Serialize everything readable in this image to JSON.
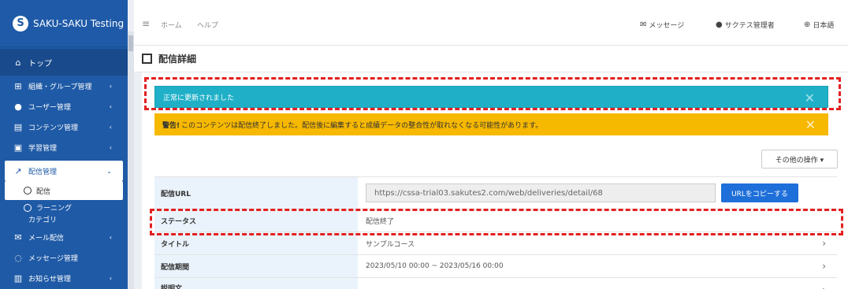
{
  "brand": {
    "logo_letter": "S",
    "name": "SAKU-SAKU Testing"
  },
  "sidebar": {
    "items": [
      {
        "label": "トップ",
        "icon": "home-icon"
      },
      {
        "label": "組織・グループ管理",
        "icon": "sitemap-icon"
      },
      {
        "label": "ユーザー管理",
        "icon": "users-icon"
      },
      {
        "label": "コンテンツ管理",
        "icon": "content-icon"
      },
      {
        "label": "学習管理",
        "icon": "learning-icon"
      },
      {
        "label": "配信管理",
        "icon": "share-icon"
      },
      {
        "label": "配信",
        "icon": "circle-icon"
      },
      {
        "label": "ラーニング",
        "label2": "カテゴリ",
        "icon": "circle-icon"
      },
      {
        "label": "メール配信",
        "icon": "mail-icon"
      },
      {
        "label": "メッセージ管理",
        "icon": "message-icon"
      },
      {
        "label": "お知らせ管理",
        "icon": "news-icon"
      }
    ]
  },
  "header": {
    "home": "ホーム",
    "help": "ヘルプ",
    "messages": "メッセージ",
    "user": "サクテス管理者",
    "language": "日本語"
  },
  "page": {
    "title": "配信詳細"
  },
  "alerts": {
    "success": "正常に更新されました",
    "warning_bold": "警告!",
    "warning_text": "このコンテンツは配信終了しました。配信後に編集すると成績データの整合性が取れなくなる可能性があります。"
  },
  "actions": {
    "more": "その他の操作 ▾"
  },
  "detail": {
    "url_label": "配信URL",
    "url_value": "https://cssa-trial03.sakutes2.com/web/deliveries/detail/68",
    "copy_button": "URLをコピーする",
    "status_label": "ステータス",
    "status_value": "配信終了",
    "title_label": "タイトル",
    "title_value": "サンプルコース",
    "period_label": "配信期間",
    "period_value": "2023/05/10 00:00 ~ 2023/05/16 00:00",
    "next_label": "説明文"
  },
  "colors": {
    "sidebar": "#1f5aa6",
    "success": "#1fb0c8",
    "warning": "#f7b800",
    "primary": "#1e6fd9",
    "annotation": "#e32020"
  }
}
